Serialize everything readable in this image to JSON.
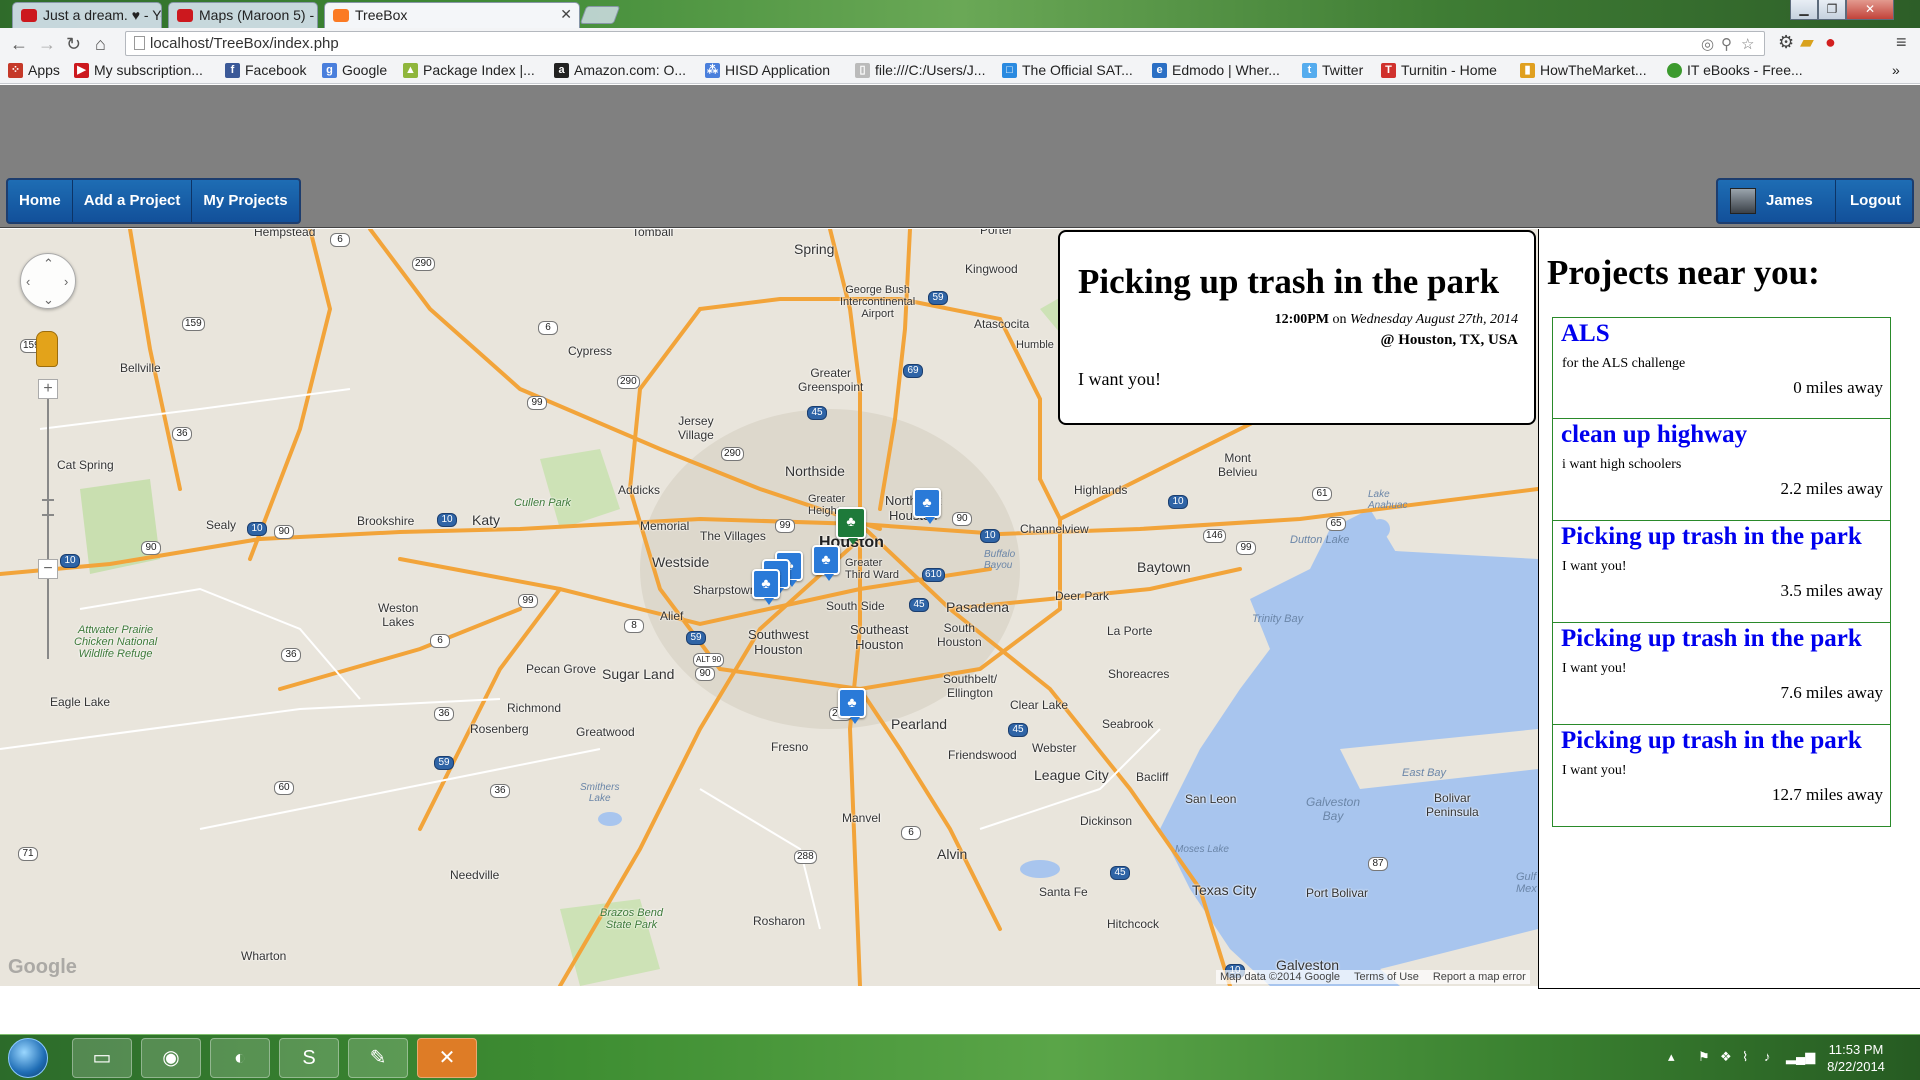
{
  "browser": {
    "tabs": [
      {
        "title": "Just a dream. ♥ - You",
        "icon": "youtube-icon",
        "color": "#cc181e"
      },
      {
        "title": "Maps (Maroon 5) - S",
        "icon": "youtube-icon",
        "color": "#cc181e"
      },
      {
        "title": "TreeBox",
        "icon": "xampp-icon",
        "color": "#fb7a24"
      }
    ],
    "url": "localhost/TreeBox/index.php",
    "bookmarks": [
      {
        "label": "Apps",
        "icon": "apps-grid-icon",
        "color": "#c53929"
      },
      {
        "label": "My subscription...",
        "icon": "youtube-icon",
        "color": "#cc181e"
      },
      {
        "label": "Facebook",
        "icon": "facebook-icon",
        "color": "#3b5998"
      },
      {
        "label": "Google",
        "icon": "google-icon",
        "color": "#4a7fdc"
      },
      {
        "label": "Package Index |...",
        "icon": "android-icon",
        "color": "#8fb63c"
      },
      {
        "label": "Amazon.com: O...",
        "icon": "amazon-icon",
        "color": "#222222"
      },
      {
        "label": "HISD Application",
        "icon": "network-icon",
        "color": "#4a7fdc"
      },
      {
        "label": "file:///C:/Users/J...",
        "icon": "page-icon",
        "color": "#bbbbbb"
      },
      {
        "label": "The Official SAT...",
        "icon": "sat-icon",
        "color": "#2a8ae0"
      },
      {
        "label": "Edmodo | Wher...",
        "icon": "edmodo-icon",
        "color": "#2b6fc4"
      },
      {
        "label": "Twitter",
        "icon": "twitter-icon",
        "color": "#55acee"
      },
      {
        "label": "Turnitin - Home",
        "icon": "turnitin-icon",
        "color": "#d0312d"
      },
      {
        "label": "HowTheMarket...",
        "icon": "chart-icon",
        "color": "#e0a020"
      },
      {
        "label": "IT eBooks - Free...",
        "icon": "ebook-icon",
        "color": "#3c9a2e"
      }
    ]
  },
  "nav": {
    "links": [
      "Home",
      "Add a Project",
      "My Projects"
    ],
    "user": "James",
    "logout": "Logout"
  },
  "map": {
    "labels": {
      "hempstead": "Hempstead",
      "tomball": "Tomball",
      "porter": "Porter",
      "spring": "Spring",
      "kingwood": "Kingwood",
      "airport": "George Bush\nIntercontinental\nAirport",
      "atascocita": "Atascocita",
      "humble": "Humble",
      "cypress": "Cypress",
      "bellville": "Bellville",
      "greater_greenspoint": "Greater\nGreenspoint",
      "jersey_village": "Jersey\nVillage",
      "northside": "Northside",
      "addicks": "Addicks",
      "cat_spring": "Cat Spring",
      "cullen_park": "Cullen Park",
      "highlands": "Highlands",
      "mont_belvieu": "Mont\nBelvieu",
      "sealy": "Sealy",
      "brookshire": "Brookshire",
      "katy": "Katy",
      "memorial": "Memorial",
      "the_villages": "The Villages",
      "greater_heights": "Greater\nHeights",
      "houston": "Houston",
      "northeast_houston": "Northeast\nHouston",
      "channelview": "Channelview",
      "lake_anahuac": "Lake\nAnahuac",
      "dutton_lake": "Dutton Lake",
      "westside": "Westside",
      "greater_third_ward": "Greater\nThird Ward",
      "buffalo_bayou": "Buffalo\nBayou",
      "baytown": "Baytown",
      "sharpstown": "Sharpstown",
      "weston_lakes": "Weston\nLakes",
      "alief": "Alief",
      "south_side": "South Side",
      "pasadena": "Pasadena",
      "deer_park": "Deer Park",
      "trinity_bay": "Trinity Bay",
      "attwater": "Attwater Prairie\nChicken National\nWildlife Refuge",
      "southwest_houston": "Southwest\nHouston",
      "southeast_houston": "Southeast\nHouston",
      "south_houston": "South\nHouston",
      "la_porte": "La Porte",
      "pecan_grove": "Pecan Grove",
      "sugar_land": "Sugar Land",
      "shoreacres": "Shoreacres",
      "southbelt": "Southbelt/\nEllington",
      "eagle_lake": "Eagle Lake",
      "richmond": "Richmond",
      "clear_lake": "Clear Lake",
      "rosenberg": "Rosenberg",
      "greatwood": "Greatwood",
      "pearland": "Pearland",
      "seabrook": "Seabrook",
      "fresno": "Fresno",
      "friendswood": "Friendswood",
      "webster": "Webster",
      "league_city": "League City",
      "bacliff": "Bacliff",
      "east_bay": "East Bay",
      "smithers_lake": "Smithers\nLake",
      "san_leon": "San Leon",
      "galveston_bay": "Galveston\nBay",
      "bolivar": "Bolivar\nPeninsula",
      "manvel": "Manvel",
      "dickinson": "Dickinson",
      "moses_lake": "Moses Lake",
      "alvin": "Alvin",
      "needville": "Needville",
      "santa_fe": "Santa Fe",
      "texas_city": "Texas City",
      "port_bolivar": "Port Bolivar",
      "gulf_mexico": "Gulf\nMex",
      "brazos_bend": "Brazos Bend\nState Park",
      "rosharon": "Rosharon",
      "hitchcock": "Hitchcock",
      "wharton": "Wharton",
      "galveston": "Galveston"
    },
    "shields": [
      "6",
      "290",
      "159",
      "6",
      "59",
      "290",
      "99",
      "45",
      "69",
      "36",
      "159",
      "290",
      "99",
      "10",
      "90",
      "10",
      "90",
      "610",
      "90",
      "10",
      "146",
      "61",
      "65",
      "99",
      "99",
      "8",
      "45",
      "59",
      "6",
      "36",
      "90",
      "ALT 90",
      "36",
      "59",
      "60",
      "36",
      "288",
      "45",
      "6",
      "71",
      "288",
      "45",
      "87",
      "10",
      "10",
      "10"
    ],
    "footer": [
      "Map data ©2014 Google",
      "Terms of Use",
      "Report a map error"
    ],
    "logo": "Google"
  },
  "infowindow": {
    "title": "Picking up trash in the park",
    "time": "12:00PM",
    "on": "on",
    "date": "Wednesday August 27th, 2014",
    "location": "@ Houston, TX, USA",
    "description": "I want you!"
  },
  "sidebar": {
    "heading": "Projects near you:",
    "projects": [
      {
        "title": "ALS",
        "description": "for the ALS challenge",
        "distance": "0 miles away"
      },
      {
        "title": "clean up highway",
        "description": "i want high schoolers",
        "distance": "2.2 miles away"
      },
      {
        "title": "Picking up trash in the park",
        "description": "I want you!",
        "distance": "3.5 miles away"
      },
      {
        "title": "Picking up trash in the park",
        "description": "I want you!",
        "distance": "7.6 miles away"
      },
      {
        "title": "Picking up trash in the park",
        "description": "I want you!",
        "distance": "12.7 miles away"
      }
    ]
  },
  "taskbar": {
    "apps": [
      "explorer",
      "chrome",
      "eclipse",
      "sublime-text",
      "paint",
      "xampp"
    ],
    "time": "11:53 PM",
    "date": "8/22/2014"
  },
  "colors": {
    "accent": "#1a5fa8",
    "header_gray": "#808080",
    "link_blue": "#0000ee",
    "project_border": "#2a8a2a",
    "marker_blue": "#2a7ad8",
    "marker_green": "#1e7a3a"
  }
}
